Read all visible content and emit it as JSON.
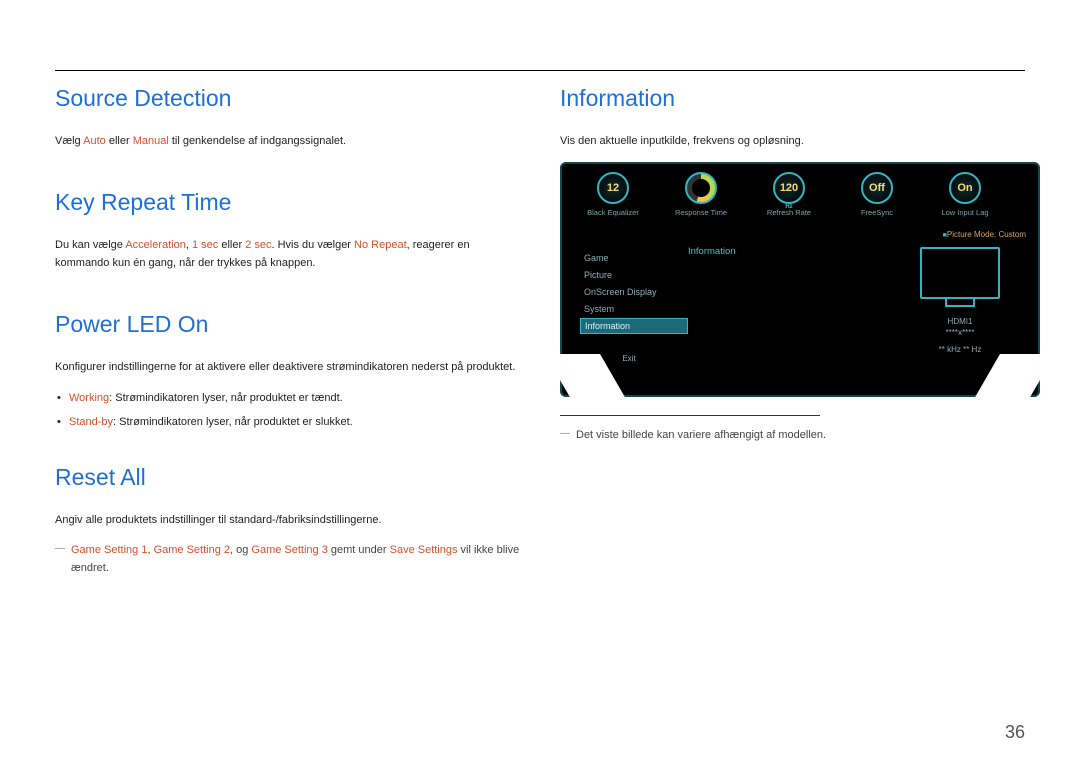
{
  "page_number": "36",
  "left": {
    "source_detection": {
      "heading": "Source Detection",
      "text_pre": "Vælg ",
      "auto": "Auto",
      "text_mid": " eller ",
      "manual": "Manual",
      "text_post": " til genkendelse af indgangssignalet."
    },
    "key_repeat": {
      "heading": "Key Repeat Time",
      "pre": "Du kan vælge ",
      "accel": "Acceleration",
      "c1": ", ",
      "s1": "1 sec",
      "c2": " eller ",
      "s2": "2 sec",
      "mid": ". Hvis du vælger ",
      "norepeat": "No Repeat",
      "post": ", reagerer en kommando kun én gang, når der trykkes på knappen."
    },
    "power_led": {
      "heading": "Power LED On",
      "intro": "Konfigurer indstillingerne for at aktivere eller deaktivere strømindikatoren nederst på produktet.",
      "working_k": "Working",
      "working_v": ": Strømindikatoren lyser, når produktet er tændt.",
      "standby_k": "Stand-by",
      "standby_v": ": Strømindikatoren lyser, når produktet er slukket."
    },
    "reset_all": {
      "heading": "Reset All",
      "intro": "Angiv alle produktets indstillinger til standard-/fabriksindstillingerne.",
      "gs1": "Game Setting 1",
      "c1": ", ",
      "gs2": "Game Setting 2",
      "c2": ", og ",
      "gs3": "Game Setting 3",
      "mid": " gemt under ",
      "save": "Save Settings",
      "post": " vil ikke blive ændret."
    }
  },
  "right": {
    "heading": "Information",
    "intro": "Vis den aktuelle inputkilde, frekvens og opløsning.",
    "footnote": "Det viste billede kan variere afhængigt af modellen."
  },
  "osd": {
    "stats": [
      {
        "value": "12",
        "label": "Black Equalizer"
      },
      {
        "value": "",
        "label": "Response Time"
      },
      {
        "value": "120",
        "label": "Refresh Rate",
        "sub": "Hz"
      },
      {
        "value": "Off",
        "label": "FreeSync"
      },
      {
        "value": "On",
        "label": "Low Input Lag"
      }
    ],
    "menu": [
      "Game",
      "Picture",
      "OnScreen Display",
      "System",
      "Information"
    ],
    "menu_selected": "Information",
    "exit": "Exit",
    "center_header": "Information",
    "picture_mode_label": "Picture Mode: ",
    "picture_mode_value": "Custom",
    "port": "HDMI1",
    "resolution": "****x****",
    "khz": "** kHz ** Hz"
  }
}
